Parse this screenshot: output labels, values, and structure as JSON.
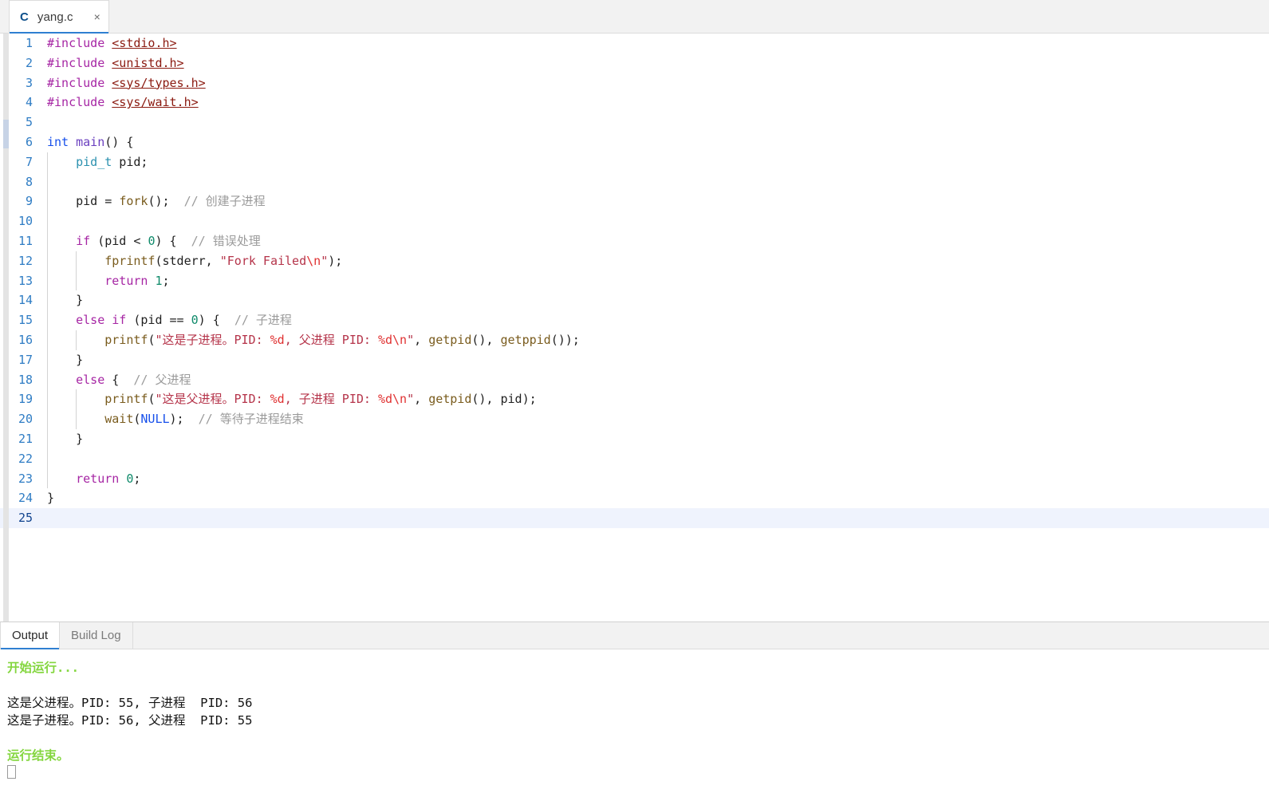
{
  "window": {
    "tab": {
      "lang_icon": "C",
      "title": "yang.c",
      "close_icon": "×"
    }
  },
  "editor": {
    "current_line": 25,
    "total_lines": 25,
    "lines": [
      {
        "n": "1",
        "tokens": [
          {
            "t": "#include ",
            "c": "t-pp"
          },
          {
            "t": "<stdio.h>",
            "c": "t-hdr"
          }
        ]
      },
      {
        "n": "2",
        "tokens": [
          {
            "t": "#include ",
            "c": "t-pp"
          },
          {
            "t": "<unistd.h>",
            "c": "t-hdr"
          }
        ]
      },
      {
        "n": "3",
        "tokens": [
          {
            "t": "#include ",
            "c": "t-pp"
          },
          {
            "t": "<sys/types.h>",
            "c": "t-hdr"
          }
        ]
      },
      {
        "n": "4",
        "tokens": [
          {
            "t": "#include ",
            "c": "t-pp"
          },
          {
            "t": "<sys/wait.h>",
            "c": "t-hdr"
          }
        ]
      },
      {
        "n": "5",
        "tokens": []
      },
      {
        "n": "6",
        "tokens": [
          {
            "t": "int ",
            "c": "t-type"
          },
          {
            "t": "main",
            "c": "t-fnmain"
          },
          {
            "t": "() {",
            "c": "t-punct"
          }
        ]
      },
      {
        "n": "7",
        "tokens": [
          {
            "t": "    ",
            "c": "t-id"
          },
          {
            "t": "pid_t",
            "c": "t-type2"
          },
          {
            "t": " pid;",
            "c": "t-id"
          }
        ]
      },
      {
        "n": "8",
        "tokens": []
      },
      {
        "n": "9",
        "tokens": [
          {
            "t": "    pid = ",
            "c": "t-id"
          },
          {
            "t": "fork",
            "c": "t-fn"
          },
          {
            "t": "();  ",
            "c": "t-punct"
          },
          {
            "t": "// 创建子进程",
            "c": "t-cmt"
          }
        ]
      },
      {
        "n": "10",
        "tokens": []
      },
      {
        "n": "11",
        "tokens": [
          {
            "t": "    ",
            "c": "t-id"
          },
          {
            "t": "if",
            "c": "t-kw"
          },
          {
            "t": " (pid < ",
            "c": "t-punct"
          },
          {
            "t": "0",
            "c": "t-num"
          },
          {
            "t": ") {  ",
            "c": "t-punct"
          },
          {
            "t": "// 错误处理",
            "c": "t-cmt"
          }
        ]
      },
      {
        "n": "12",
        "tokens": [
          {
            "t": "        ",
            "c": "t-id"
          },
          {
            "t": "fprintf",
            "c": "t-fn"
          },
          {
            "t": "(stderr, ",
            "c": "t-punct"
          },
          {
            "t": "\"Fork Failed",
            "c": "t-str"
          },
          {
            "t": "\\n",
            "c": "t-esc"
          },
          {
            "t": "\"",
            "c": "t-str"
          },
          {
            "t": ");",
            "c": "t-punct"
          }
        ]
      },
      {
        "n": "13",
        "tokens": [
          {
            "t": "        ",
            "c": "t-id"
          },
          {
            "t": "return",
            "c": "t-kw"
          },
          {
            "t": " ",
            "c": "t-punct"
          },
          {
            "t": "1",
            "c": "t-num"
          },
          {
            "t": ";",
            "c": "t-punct"
          }
        ]
      },
      {
        "n": "14",
        "tokens": [
          {
            "t": "    }",
            "c": "t-punct"
          }
        ]
      },
      {
        "n": "15",
        "tokens": [
          {
            "t": "    ",
            "c": "t-id"
          },
          {
            "t": "else if",
            "c": "t-kw"
          },
          {
            "t": " (pid == ",
            "c": "t-punct"
          },
          {
            "t": "0",
            "c": "t-num"
          },
          {
            "t": ") {  ",
            "c": "t-punct"
          },
          {
            "t": "// 子进程",
            "c": "t-cmt"
          }
        ]
      },
      {
        "n": "16",
        "tokens": [
          {
            "t": "        ",
            "c": "t-id"
          },
          {
            "t": "printf",
            "c": "t-fn"
          },
          {
            "t": "(",
            "c": "t-punct"
          },
          {
            "t": "\"这是子进程。PID: ",
            "c": "t-str"
          },
          {
            "t": "%d",
            "c": "t-esc"
          },
          {
            "t": ", 父进程 PID: ",
            "c": "t-str"
          },
          {
            "t": "%d\\n",
            "c": "t-esc"
          },
          {
            "t": "\"",
            "c": "t-str"
          },
          {
            "t": ", ",
            "c": "t-punct"
          },
          {
            "t": "getpid",
            "c": "t-fn"
          },
          {
            "t": "(), ",
            "c": "t-punct"
          },
          {
            "t": "getppid",
            "c": "t-fn"
          },
          {
            "t": "());",
            "c": "t-punct"
          }
        ]
      },
      {
        "n": "17",
        "tokens": [
          {
            "t": "    }",
            "c": "t-punct"
          }
        ]
      },
      {
        "n": "18",
        "tokens": [
          {
            "t": "    ",
            "c": "t-id"
          },
          {
            "t": "else",
            "c": "t-kw"
          },
          {
            "t": " {  ",
            "c": "t-punct"
          },
          {
            "t": "// 父进程",
            "c": "t-cmt"
          }
        ]
      },
      {
        "n": "19",
        "tokens": [
          {
            "t": "        ",
            "c": "t-id"
          },
          {
            "t": "printf",
            "c": "t-fn"
          },
          {
            "t": "(",
            "c": "t-punct"
          },
          {
            "t": "\"这是父进程。PID: ",
            "c": "t-str"
          },
          {
            "t": "%d",
            "c": "t-esc"
          },
          {
            "t": ", 子进程 PID: ",
            "c": "t-str"
          },
          {
            "t": "%d\\n",
            "c": "t-esc"
          },
          {
            "t": "\"",
            "c": "t-str"
          },
          {
            "t": ", ",
            "c": "t-punct"
          },
          {
            "t": "getpid",
            "c": "t-fn"
          },
          {
            "t": "(), pid);",
            "c": "t-punct"
          }
        ]
      },
      {
        "n": "20",
        "tokens": [
          {
            "t": "        ",
            "c": "t-id"
          },
          {
            "t": "wait",
            "c": "t-fn"
          },
          {
            "t": "(",
            "c": "t-punct"
          },
          {
            "t": "NULL",
            "c": "t-type"
          },
          {
            "t": ");  ",
            "c": "t-punct"
          },
          {
            "t": "// 等待子进程结束",
            "c": "t-cmt"
          }
        ]
      },
      {
        "n": "21",
        "tokens": [
          {
            "t": "    }",
            "c": "t-punct"
          }
        ]
      },
      {
        "n": "22",
        "tokens": []
      },
      {
        "n": "23",
        "tokens": [
          {
            "t": "    ",
            "c": "t-id"
          },
          {
            "t": "return",
            "c": "t-kw"
          },
          {
            "t": " ",
            "c": "t-punct"
          },
          {
            "t": "0",
            "c": "t-num"
          },
          {
            "t": ";",
            "c": "t-punct"
          }
        ]
      },
      {
        "n": "24",
        "tokens": [
          {
            "t": "}",
            "c": "t-punct"
          }
        ]
      },
      {
        "n": "25",
        "tokens": []
      }
    ]
  },
  "output": {
    "tabs": [
      {
        "label": "Output",
        "active": true
      },
      {
        "label": "Build Log",
        "active": false
      }
    ],
    "lines": [
      {
        "text": "开始运行...",
        "style": "green"
      },
      {
        "text": "",
        "style": "blank"
      },
      {
        "text": "这是父进程。PID: 55, 子进程  PID: 56",
        "style": "plain"
      },
      {
        "text": "这是子进程。PID: 56, 父进程  PID: 55",
        "style": "plain"
      },
      {
        "text": "",
        "style": "blank"
      },
      {
        "text": "运行结束。",
        "style": "green"
      },
      {
        "text": "",
        "style": "tofu"
      }
    ]
  },
  "colors": {
    "accent": "#2f7fd1",
    "green": "#84d63f",
    "current_line_bg": "#eff3fd",
    "line_number": "#2e7cc4",
    "tabbar_bg": "#f2f2f2"
  }
}
